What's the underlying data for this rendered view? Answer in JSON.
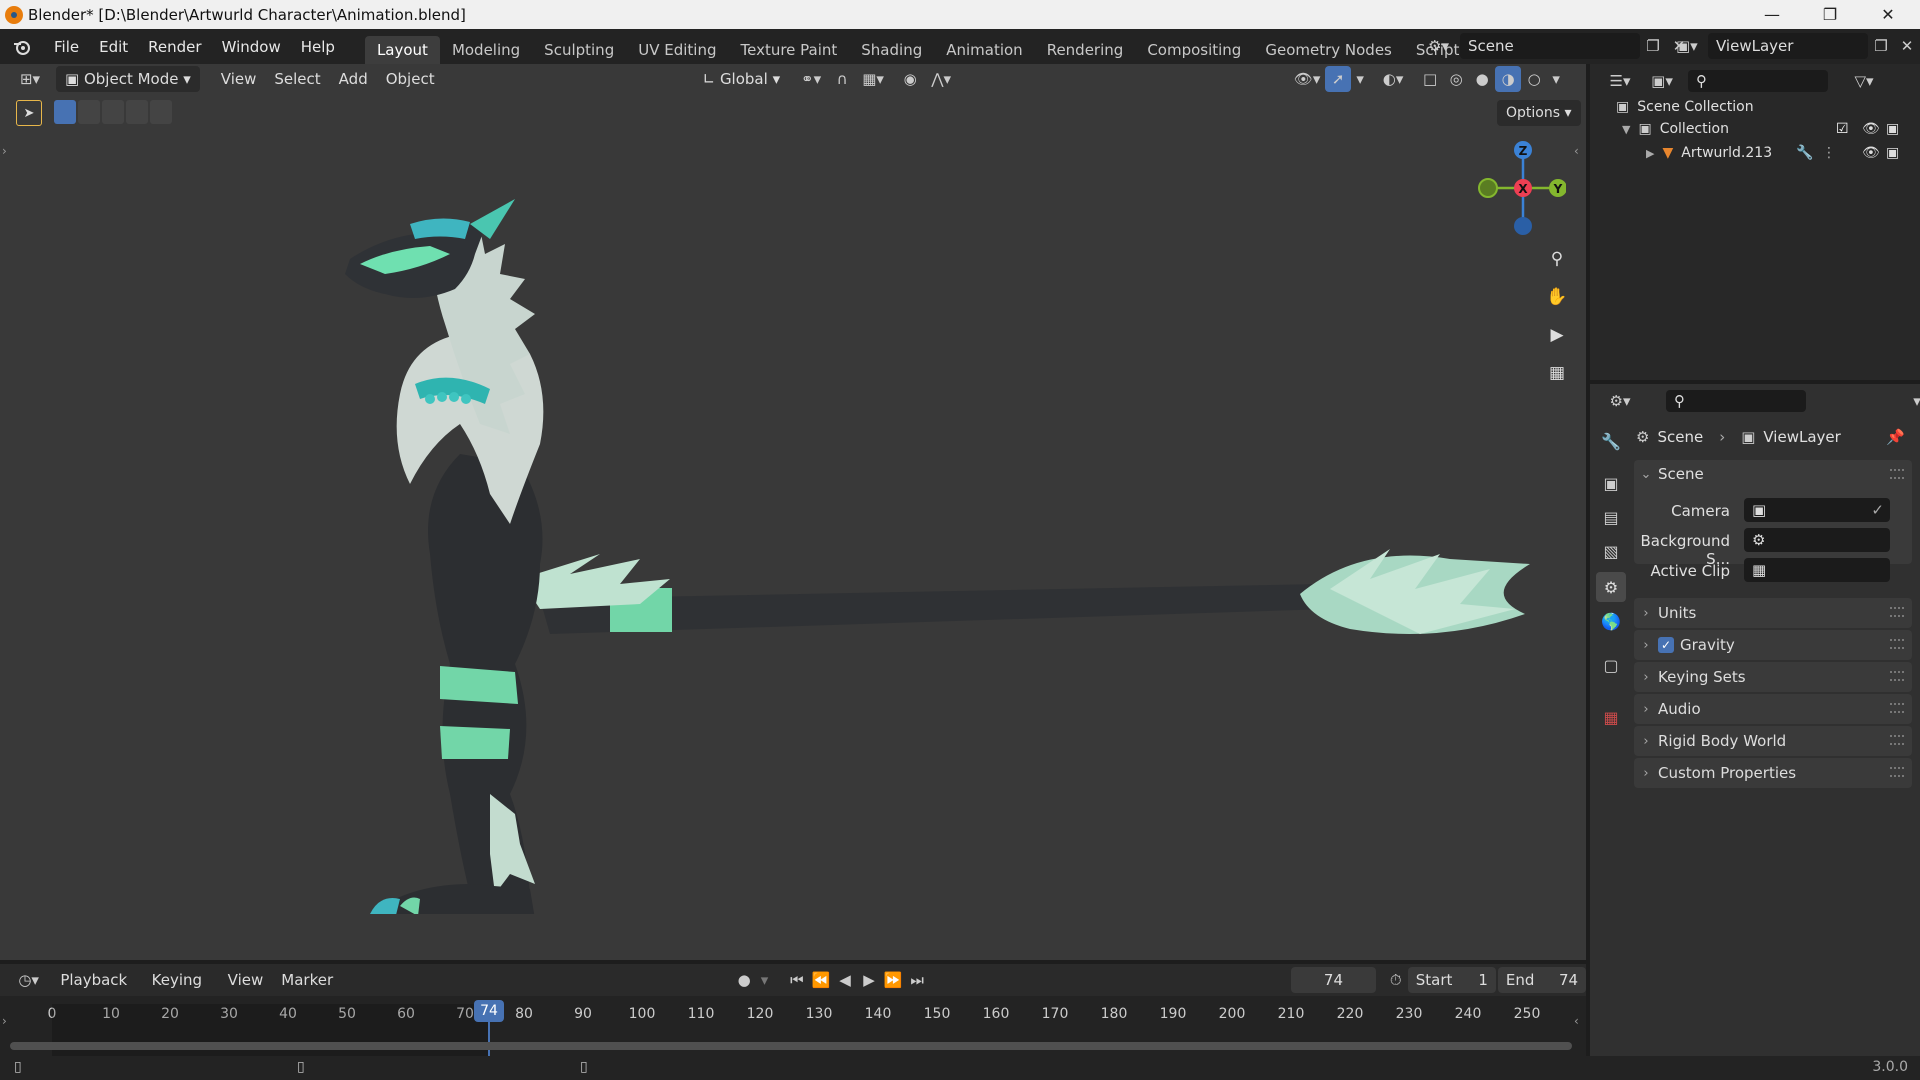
{
  "window": {
    "title": "Blender* [D:\\Blender\\Artwurld Character\\Animation.blend]"
  },
  "menu": [
    "File",
    "Edit",
    "Render",
    "Window",
    "Help"
  ],
  "workspaces": [
    "Layout",
    "Modeling",
    "Sculpting",
    "UV Editing",
    "Texture Paint",
    "Shading",
    "Animation",
    "Rendering",
    "Compositing",
    "Geometry Nodes",
    "Scripting"
  ],
  "scene_field": "Scene",
  "view_layer_field": "ViewLayer",
  "viewport": {
    "mode": "Object Mode",
    "menus": [
      "View",
      "Select",
      "Add",
      "Object"
    ],
    "transform_orientation": "Global",
    "options_label": "Options",
    "gizmo": {
      "z": "Z",
      "x": "X",
      "y": "Y"
    }
  },
  "outliner": {
    "scene_collection": "Scene Collection",
    "collection": "Collection",
    "object": "Artwurld.213"
  },
  "properties": {
    "breadcrumb_scene": "Scene",
    "breadcrumb_view_layer": "ViewLayer",
    "scene_panel": "Scene",
    "camera_label": "Camera",
    "background_label": "Background S...",
    "active_clip_label": "Active Clip",
    "panels": [
      "Units",
      "Gravity",
      "Keying Sets",
      "Audio",
      "Rigid Body World",
      "Custom Properties"
    ]
  },
  "timeline": {
    "menus": [
      "Playback",
      "Keying",
      "View",
      "Marker"
    ],
    "current_frame": "74",
    "start_label": "Start",
    "start_value": "1",
    "end_label": "End",
    "end_value": "74",
    "ticks": [
      "0",
      "10",
      "20",
      "30",
      "40",
      "50",
      "60",
      "70",
      "80",
      "90",
      "100",
      "110",
      "120",
      "130",
      "140",
      "150",
      "160",
      "170",
      "180",
      "190",
      "200",
      "210",
      "220",
      "230",
      "240",
      "250"
    ],
    "playhead": "74"
  },
  "statusbar": {
    "version": "3.0.0"
  },
  "colors": {
    "accent": "#4772b3",
    "orange": "#e87d0d",
    "gizmo_x": "#ee3f53",
    "gizmo_y": "#84b72e",
    "gizmo_z": "#3b82d6"
  }
}
